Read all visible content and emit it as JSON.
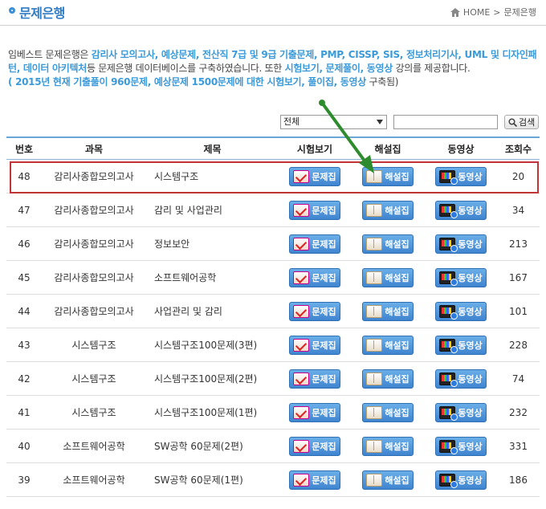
{
  "header": {
    "title": "문제은행",
    "breadcrumb_home": "HOME",
    "breadcrumb_sep": ">",
    "breadcrumb_current": "문제은행"
  },
  "intro": {
    "p1": "임베스트 문제은행은 ",
    "h1": "감리사 모의고사, 예상문제, 전산직 7급 및 9급 기출문제, PMP, CISSP, SIS, 정보처리기사, UML 및 디자인패턴, 데이터 아키텍처",
    "p2": "등 문제은행 데이터베이스를 구축하였습니다. 또한 ",
    "h2": "시험보기, 문제풀이, 동영상",
    "p3": " 강의를 제공합니다.",
    "p4": "( ",
    "h3": "2015년 현재 기출풀이 960문제, 예상문제 1500문제에 대한 시험보기, 풀이집, 동영상",
    "p5": " 구축됨)"
  },
  "search": {
    "select_value": "전체",
    "input_value": "",
    "button_label": "검색"
  },
  "table": {
    "headers": [
      "번호",
      "과목",
      "제목",
      "시험보기",
      "해설집",
      "동영상",
      "조회수"
    ],
    "button_labels": {
      "exam": "문제집",
      "solution": "해설집",
      "video": "동영상"
    },
    "rows": [
      {
        "no": "48",
        "course": "감리사종합모의고사",
        "subject": "시스템구조",
        "views": "20"
      },
      {
        "no": "47",
        "course": "감리사종합모의고사",
        "subject": "감리 및 사업관리",
        "views": "34"
      },
      {
        "no": "46",
        "course": "감리사종합모의고사",
        "subject": "정보보안",
        "views": "213"
      },
      {
        "no": "45",
        "course": "감리사종합모의고사",
        "subject": "소프트웨어공학",
        "views": "167"
      },
      {
        "no": "44",
        "course": "감리사종합모의고사",
        "subject": "사업관리 및 감리",
        "views": "101"
      },
      {
        "no": "43",
        "course": "시스템구조",
        "subject": "시스템구조100문제(3편)",
        "views": "228"
      },
      {
        "no": "42",
        "course": "시스템구조",
        "subject": "시스템구조100문제(2편)",
        "views": "74"
      },
      {
        "no": "41",
        "course": "시스템구조",
        "subject": "시스템구조100문제(1편)",
        "views": "232"
      },
      {
        "no": "40",
        "course": "소프트웨어공학",
        "subject": "SW공학 60문제(2편)",
        "views": "331"
      },
      {
        "no": "39",
        "course": "소프트웨어공학",
        "subject": "SW공학 60문제(1편)",
        "views": "186"
      }
    ]
  },
  "colors": {
    "accent": "#2f7cc7",
    "highlight_text": "#3b9ad9",
    "annotation_box": "#c0343a",
    "annotation_arrow": "#2e8b2e"
  }
}
